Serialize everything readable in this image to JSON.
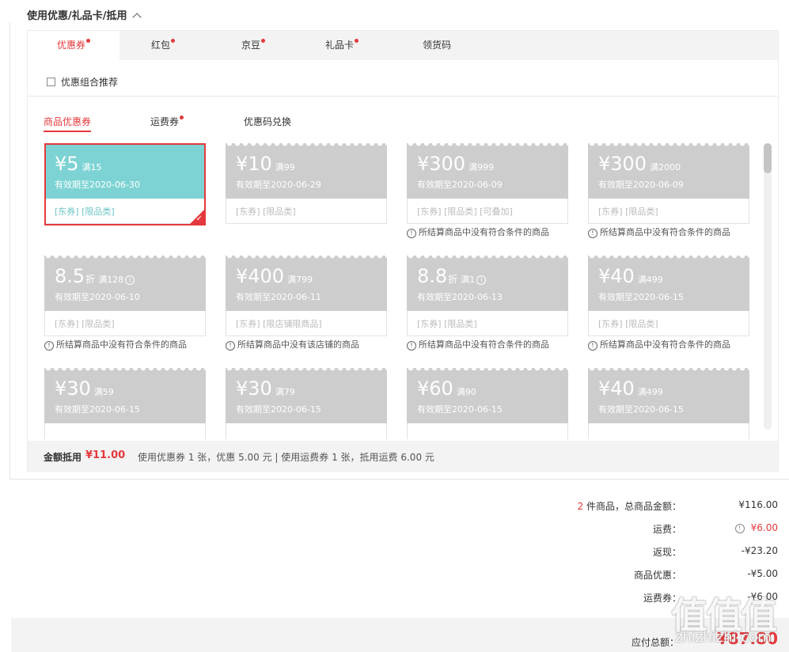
{
  "section": {
    "title": "使用优惠/礼品卡/抵用"
  },
  "tabs": [
    {
      "label": "优惠券",
      "dot": true
    },
    {
      "label": "红包",
      "dot": true
    },
    {
      "label": "京豆",
      "dot": true
    },
    {
      "label": "礼品卡",
      "dot": true
    },
    {
      "label": "领货码",
      "dot": false
    }
  ],
  "combo_label": "优惠组合推荐",
  "subtabs": [
    {
      "label": "商品优惠券",
      "dot": false
    },
    {
      "label": "运费券",
      "dot": true
    },
    {
      "label": "优惠码兑换",
      "dot": false
    }
  ],
  "coupons": [
    {
      "amount": "¥5",
      "full": "满15",
      "valid": "有效期至2020-06-30",
      "tags": "[东券]  [限品类]",
      "selected": true,
      "reason": ""
    },
    {
      "amount": "¥10",
      "full": "满99",
      "valid": "有效期至2020-06-29",
      "tags": "[东券]  [限品类]",
      "selected": false,
      "reason": ""
    },
    {
      "amount": "¥300",
      "full": "满999",
      "valid": "有效期至2020-06-09",
      "tags": "[东券]  [限品类]  [可叠加]",
      "selected": false,
      "reason": "所结算商品中没有符合条件的商品"
    },
    {
      "amount": "¥300",
      "full": "满2000",
      "valid": "有效期至2020-06-09",
      "tags": "[东券]  [限品类]",
      "selected": false,
      "reason": "所结算商品中没有符合条件的商品"
    },
    {
      "amount": "8.5",
      "zhe": "折",
      "full": "满128",
      "info": "i",
      "valid": "有效期至2020-06-10",
      "tags": "[东券]  [限品类]",
      "selected": false,
      "reason": "所结算商品中没有符合条件的商品"
    },
    {
      "amount": "¥400",
      "full": "满799",
      "valid": "有效期至2020-06-11",
      "tags": "[东券]  [限店铺限商品]",
      "selected": false,
      "reason": "所结算商品中没有该店铺的商品"
    },
    {
      "amount": "8.8",
      "zhe": "折",
      "full": "满1",
      "info": "i",
      "valid": "有效期至2020-06-13",
      "tags": "[东券]  [限品类]",
      "selected": false,
      "reason": "所结算商品中没有符合条件的商品"
    },
    {
      "amount": "¥40",
      "full": "满499",
      "valid": "有效期至2020-06-15",
      "tags": "[东券]  [限品类]",
      "selected": false,
      "reason": "所结算商品中没有符合条件的商品"
    },
    {
      "amount": "¥30",
      "full": "满59",
      "valid": "有效期至2020-06-15",
      "tags": "",
      "selected": false,
      "reason": ""
    },
    {
      "amount": "¥30",
      "full": "满79",
      "valid": "有效期至2020-06-15",
      "tags": "",
      "selected": false,
      "reason": ""
    },
    {
      "amount": "¥60",
      "full": "满90",
      "valid": "有效期至2020-06-15",
      "tags": "",
      "selected": false,
      "reason": ""
    },
    {
      "amount": "¥40",
      "full": "满499",
      "valid": "有效期至2020-06-15",
      "tags": "",
      "selected": false,
      "reason": ""
    }
  ],
  "summary": {
    "label": "金额抵用",
    "amount": "¥11.00",
    "desc": "使用优惠券 1 张，优惠 5.00 元  | 使用运费券 1 张，抵用运费 6.00 元"
  },
  "prices": {
    "goods_count": "2",
    "goods_label": "件商品，总商品金额：",
    "goods_total": "¥116.00",
    "shipping_label": "运费：",
    "shipping": "¥6.00",
    "cashback_label": "返现：",
    "cashback": "-¥23.20",
    "discount_label": "商品优惠：",
    "discount": "-¥5.00",
    "ship_coupon_label": "运费券：",
    "ship_coupon": "-¥6.00"
  },
  "total": {
    "label": "应付总额：",
    "value": "¥87.80"
  },
  "watermark": {
    "site": "zhizhizhi.com"
  },
  "colors": {
    "accent": "#e4393c",
    "selected_coupon": "#7dd3d3",
    "disabled_coupon": "#cdcdcd"
  }
}
